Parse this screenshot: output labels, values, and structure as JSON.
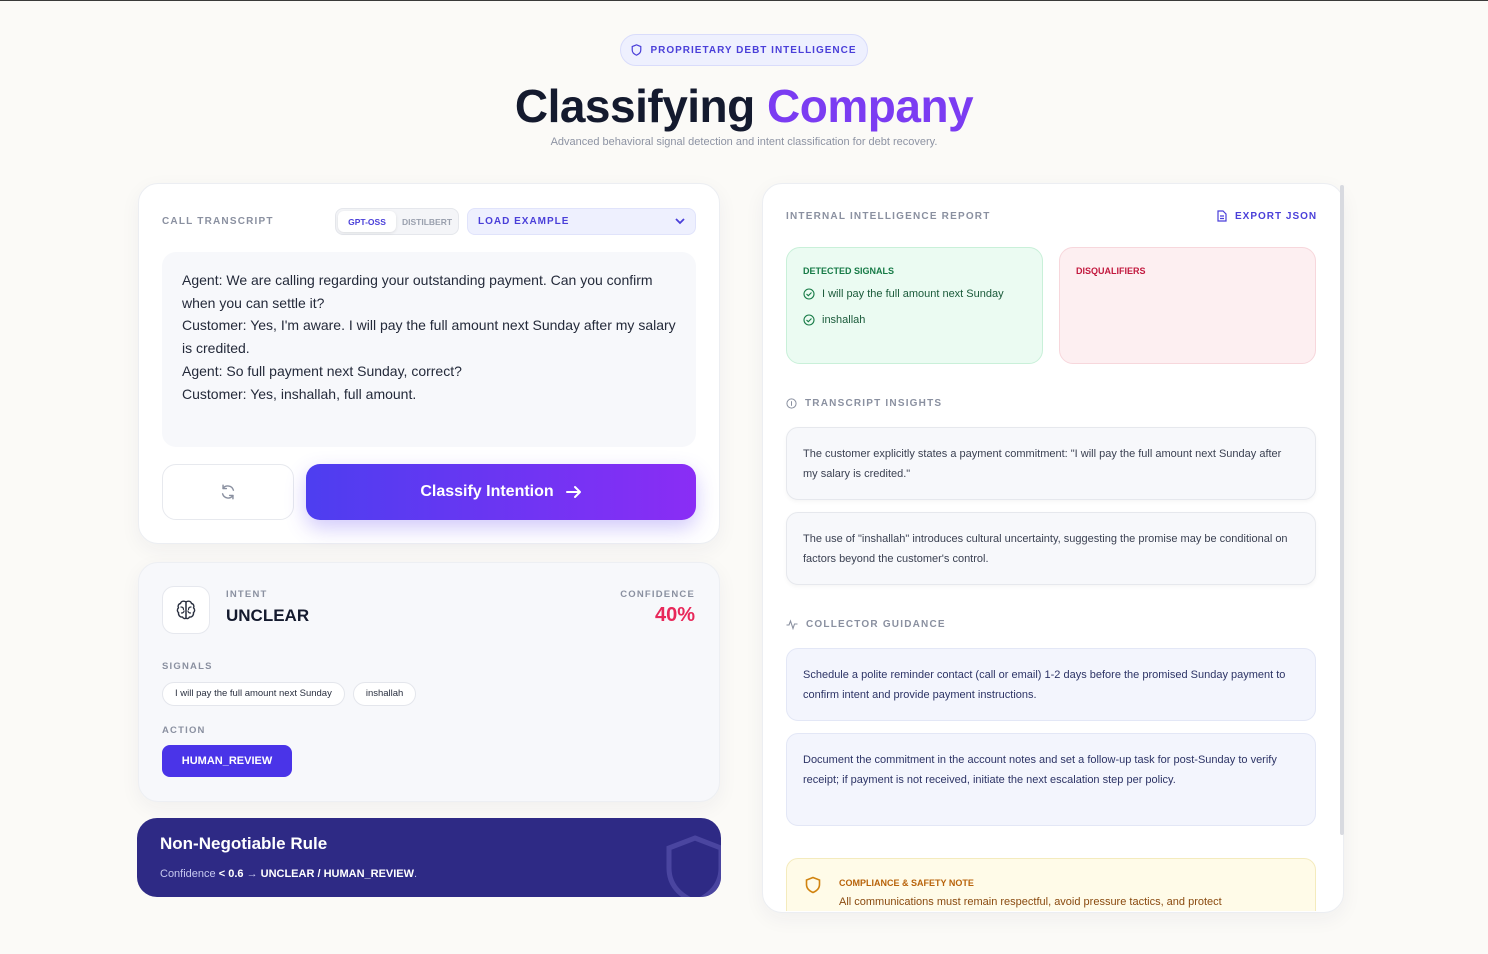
{
  "header": {
    "badge": "PROPRIETARY DEBT INTELLIGENCE",
    "title_main": "Classifying",
    "title_accent": "Company",
    "subtitle": "Advanced behavioral signal detection and intent classification for debt recovery."
  },
  "transcript_panel": {
    "label": "CALL TRANSCRIPT",
    "models": [
      "GPT-OSS",
      "DISTILBERT"
    ],
    "active_model": "GPT-OSS",
    "load_example": "LOAD EXAMPLE",
    "lines": [
      "Agent: We are calling regarding your outstanding payment. Can you confirm when you can settle it?",
      "Customer: Yes, I'm aware. I will pay the full amount next Sunday after my salary is credited.",
      "Agent: So full payment next Sunday, correct?",
      "Customer: Yes, inshallah, full amount."
    ],
    "classify_button": "Classify Intention"
  },
  "result": {
    "intent_label": "INTENT",
    "intent_value": "UNCLEAR",
    "confidence_label": "CONFIDENCE",
    "confidence_value": "40%",
    "signals_label": "SIGNALS",
    "signals": [
      "I will pay the full amount next Sunday",
      "inshallah"
    ],
    "action_label": "ACTION",
    "action_value": "HUMAN_REVIEW"
  },
  "rule": {
    "title": "Non-Negotiable Rule",
    "prefix": "Confidence",
    "condition": "< 0.6",
    "arrow": "→",
    "outcome": "UNCLEAR / HUMAN_REVIEW",
    "suffix": "."
  },
  "report": {
    "label": "INTERNAL INTELLIGENCE REPORT",
    "export": "EXPORT JSON",
    "detected_label": "DETECTED SIGNALS",
    "detected": [
      "I will pay the full amount next Sunday",
      "inshallah"
    ],
    "disqualifiers_label": "DISQUALIFIERS",
    "insights_label": "TRANSCRIPT INSIGHTS",
    "insights": [
      "The customer explicitly states a payment commitment: \"I will pay the full amount next Sunday after my salary is credited.\"",
      "The use of \"inshallah\" introduces cultural uncertainty, suggesting the promise may be conditional on factors beyond the customer's control."
    ],
    "guidance_label": "COLLECTOR GUIDANCE",
    "guidance": [
      "Schedule a polite reminder contact (call or email) 1-2 days before the promised Sunday payment to confirm intent and provide payment instructions.",
      "Document the commitment in the account notes and set a follow-up task for post-Sunday to verify receipt; if payment is not received, initiate the next escalation step per policy."
    ],
    "compliance_label": "COMPLIANCE & SAFETY NOTE",
    "compliance_text": "All communications must remain respectful, avoid pressure tactics, and protect"
  },
  "colors": {
    "accent": "#7b3cf2",
    "primary": "#4a34e8",
    "confidence": "#e8285a",
    "rule_bg": "#2e2a85"
  }
}
